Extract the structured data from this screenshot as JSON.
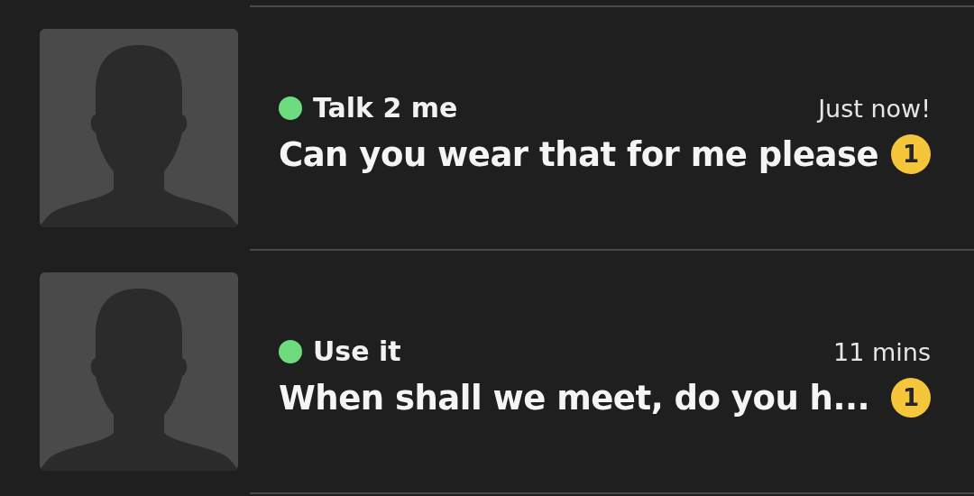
{
  "conversations": [
    {
      "name": "Talk 2 me",
      "online": true,
      "time": "Just now!",
      "message": "Can you wear that for me please",
      "unread": "1"
    },
    {
      "name": "Use it",
      "online": true,
      "time": "11 mins",
      "message": "When shall we meet, do you h...",
      "unread": "1"
    }
  ]
}
